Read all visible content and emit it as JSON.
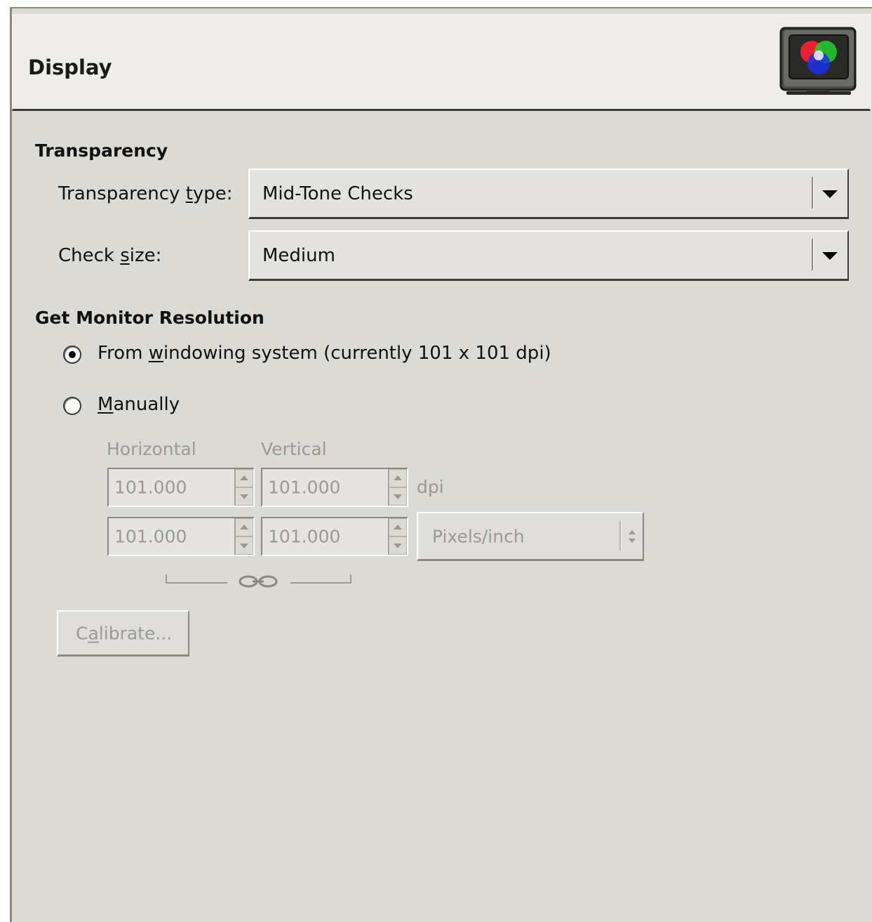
{
  "header": {
    "title": "Display",
    "icon": "monitor-color-icon"
  },
  "transparency": {
    "section_title": "Transparency",
    "type_label_pre": "Transparency ",
    "type_label_u": "t",
    "type_label_post": "ype:",
    "type_value": "Mid-Tone Checks",
    "check_label_pre": "Check ",
    "check_label_u": "s",
    "check_label_post": "ize:",
    "check_value": "Medium"
  },
  "monitor": {
    "section_title": "Get Monitor Resolution",
    "from_pre": "From ",
    "from_u": "w",
    "from_post": "indowing system (currently 101 x 101 dpi)",
    "from_selected": true,
    "manual_u": "M",
    "manual_post": "anually",
    "manual_selected": false,
    "horizontal_label": "Horizontal",
    "vertical_label": "Vertical",
    "dpi_h": "101.000",
    "dpi_v": "101.000",
    "dpi_unit": "dpi",
    "res_h": "101.000",
    "res_v": "101.000",
    "res_unit": "Pixels/inch",
    "chain_icon": "chain-link-icon",
    "calibrate_pre": "C",
    "calibrate_u": "a",
    "calibrate_post": "librate..."
  },
  "colors": {
    "panel_bg": "#dcdad5",
    "header_bg": "#efedea",
    "disabled_text": "#9a9993"
  }
}
